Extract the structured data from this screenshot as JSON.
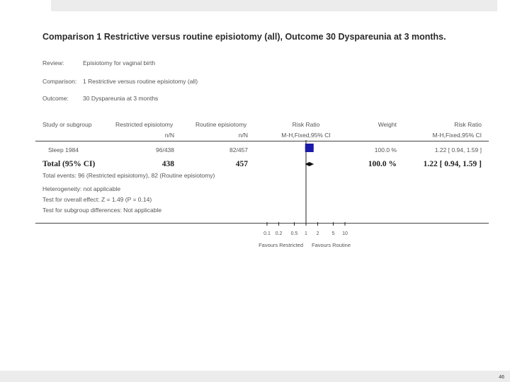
{
  "slide_number": "46",
  "title": "Comparison 1 Restrictive versus routine episiotomy (all), Outcome 30 Dyspareunia at 3  months.",
  "meta": {
    "review_label": "Review:",
    "review_value": "Episiotomy for vaginal birth",
    "comparison_label": "Comparison:",
    "comparison_value": "1 Restrictive versus routine episiotomy (all)",
    "outcome_label": "Outcome:",
    "outcome_value": "30 Dyspareunia at 3 months"
  },
  "headers": {
    "study": "Study or subgroup",
    "restricted": "Restricted episiotomy",
    "restricted_sub": "n/N",
    "routine": "Routine episiotomy",
    "routine_sub": "n/N",
    "rr": "Risk Ratio",
    "rr_sub": "M-H,Fixed,95% CI",
    "weight": "Weight",
    "rr2": "Risk Ratio",
    "rr2_sub": "M-H,Fixed,95% CI"
  },
  "study_row": {
    "name": "Sleep 1984",
    "restricted": "96/438",
    "routine": "82/457",
    "weight": "100.0 %",
    "ci": "1.22 [ 0.94, 1.59 ]"
  },
  "total_row": {
    "label": "Total (95% CI)",
    "restricted": "438",
    "routine": "457",
    "weight": "100.0 %",
    "ci": "1.22 [ 0.94, 1.59 ]"
  },
  "footnotes": {
    "total_events": "Total events: 96 (Restricted episiotomy), 82 (Routine episiotomy)",
    "heterogeneity": "Heterogeneity: not applicable",
    "overall_effect": "Test for overall effect: Z = 1.49 (P = 0.14)",
    "subgroup": "Test for subgroup differences: Not applicable"
  },
  "chart_data": {
    "type": "forest",
    "scale": "log",
    "xlim": [
      0.1,
      10
    ],
    "ticks": [
      "0.1",
      "0.2",
      "0.5",
      "1",
      "2",
      "5",
      "10"
    ],
    "tick_values": [
      0.1,
      0.2,
      0.5,
      1,
      2,
      5,
      10
    ],
    "favours_left": "Favours Restricted",
    "favours_right": "Favours Routine",
    "study_estimate": {
      "rr": 1.22,
      "lower": 0.94,
      "upper": 1.59,
      "weight": 100.0
    },
    "pooled_estimate": {
      "rr": 1.22,
      "lower": 0.94,
      "upper": 1.59
    },
    "colors": {
      "marker": "#1a1aa8",
      "line": "#222222"
    }
  }
}
